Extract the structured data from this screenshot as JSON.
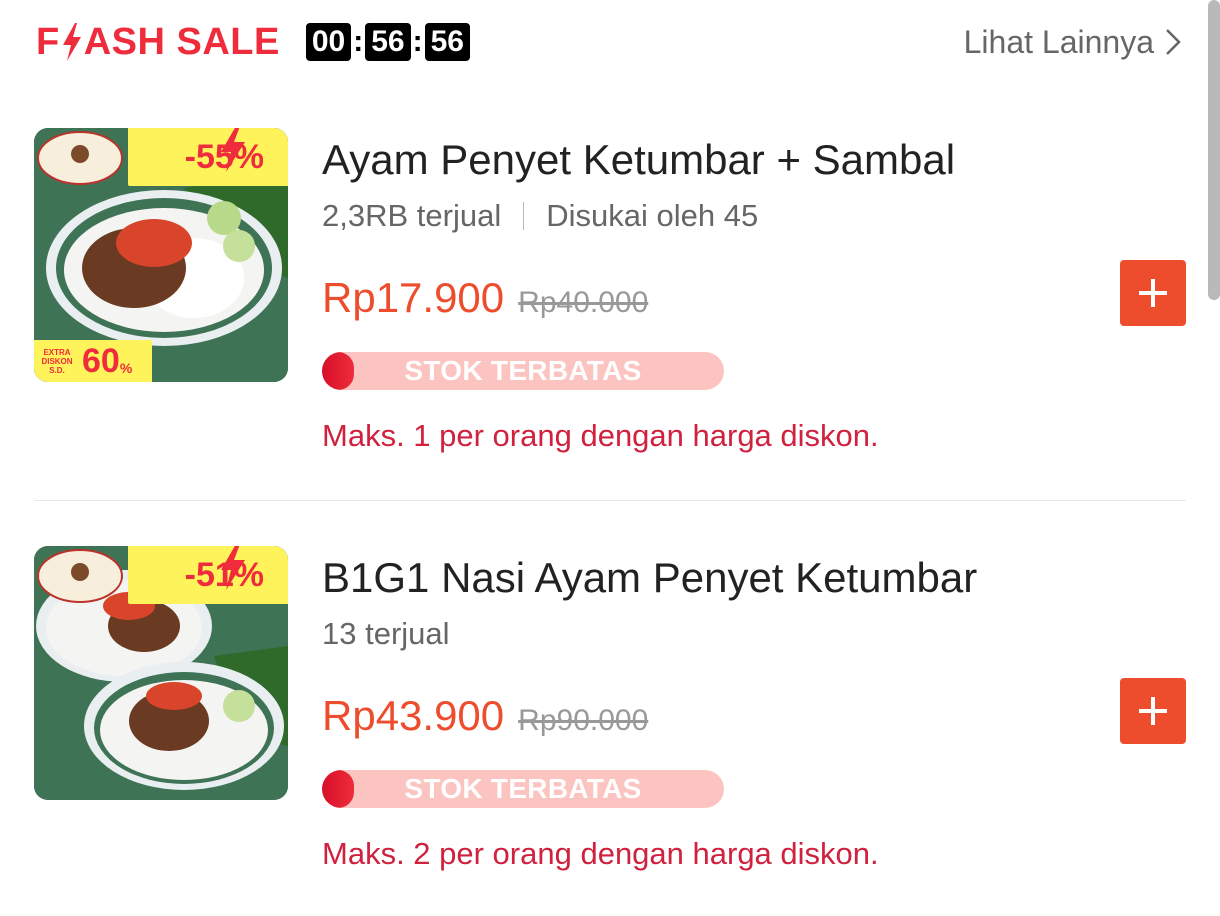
{
  "header": {
    "flash_prefix": "F",
    "flash_suffix": "ASH SALE",
    "timer": {
      "hours": "00",
      "minutes": "56",
      "seconds": "56"
    },
    "see_more": "Lihat Lainnya"
  },
  "colors": {
    "accent": "#ee2c3b",
    "price": "#ee4d2d",
    "limit_text": "#d0213e",
    "stock_track": "#fbc4c0"
  },
  "items": [
    {
      "title": "Ayam Penyet Ketumbar + Sambal",
      "sold": "2,3RB terjual",
      "likes": "Disukai oleh 45",
      "price": "Rp17.900",
      "original_price": "Rp40.000",
      "discount": "-55%",
      "extra_badge": {
        "small": "EXTRA DISKON S.D.",
        "big": "60",
        "pct": "%"
      },
      "stock_label": "STOK TERBATAS",
      "stock_level": 0.08,
      "limit": "Maks. 1 per orang dengan harga diskon."
    },
    {
      "title": "B1G1 Nasi Ayam Penyet Ketumbar",
      "sold": "13 terjual",
      "price": "Rp43.900",
      "original_price": "Rp90.000",
      "discount": "-51%",
      "stock_label": "STOK TERBATAS",
      "stock_level": 0.08,
      "limit": "Maks. 2 per orang dengan harga diskon."
    }
  ]
}
